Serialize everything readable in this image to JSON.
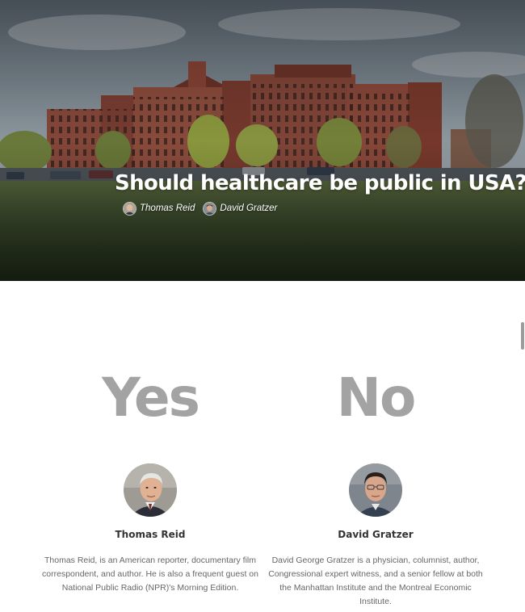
{
  "hero": {
    "title": "Should healthcare be public in USA?",
    "authors": [
      {
        "name": "Thomas Reid"
      },
      {
        "name": "David Gratzer"
      }
    ]
  },
  "sides": [
    {
      "heading": "Yes",
      "person": {
        "name": "Thomas Reid",
        "bio": "Thomas Reid, is an American reporter, documentary film correspondent, and author. He is also a frequent guest on National Public Radio (NPR)'s Morning Edition."
      }
    },
    {
      "heading": "No",
      "person": {
        "name": "David Gratzer",
        "bio": "David George Gratzer is a physician, columnist, author, Congressional expert witness, and a senior fellow at both the Manhattan Institute and the Montreal Economic Institute."
      }
    }
  ],
  "colors": {
    "heading_gray": "#a3a3a3",
    "name_text": "#333333",
    "bio_text": "#666666",
    "hero_text": "#ffffff"
  }
}
